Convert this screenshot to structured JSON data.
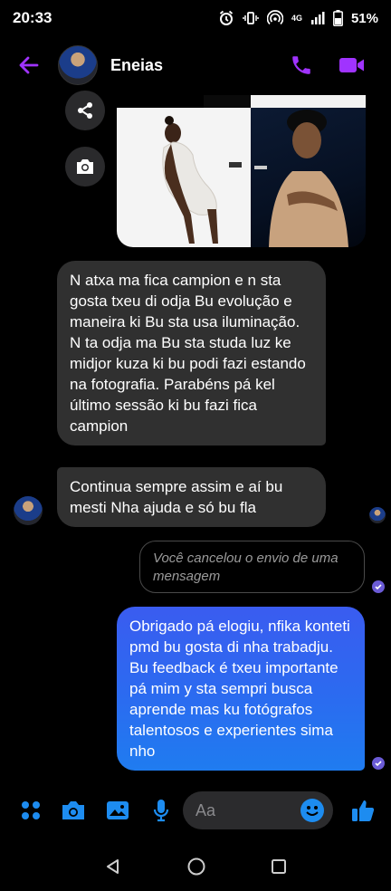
{
  "status": {
    "time": "20:33",
    "network": "4G",
    "battery": "51%"
  },
  "header": {
    "contact_name": "Eneias"
  },
  "messages": {
    "incoming_1": "N atxa ma fica campion e n sta gosta txeu di odja Bu evolução e maneira ki Bu sta usa iluminação. N ta odja ma Bu sta studa luz ke midjor kuza ki bu podi fazi estando na fotografia. Parabéns pá kel último sessão ki bu fazi  fica campion",
    "incoming_2": "Continua sempre assim e aí bu mesti Nha ajuda e só bu fla",
    "unsent_notice": "Você cancelou o envio de uma mensagem",
    "outgoing_1": "Obrigado pá elogiu, nfika konteti pmd bu gosta di nha trabadju. Bu feedback é txeu importante pá mim y sta sempri busca aprende mas ku fotógrafos talentosos e experientes sima nho"
  },
  "composer": {
    "placeholder": "Aa"
  },
  "colors": {
    "accent": "#a033ff",
    "outgoing_bubble": "#2f63f0",
    "incoming_bubble": "#303030",
    "icon_blue": "#1d8cf0"
  }
}
